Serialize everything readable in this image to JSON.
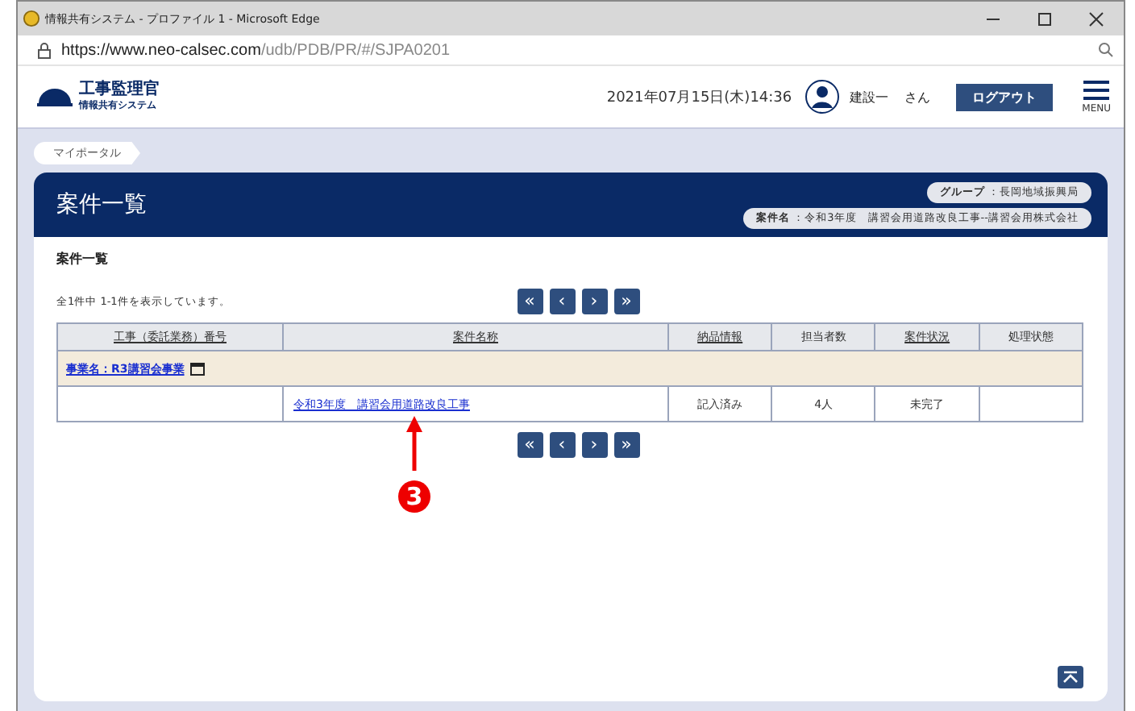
{
  "window": {
    "title": "情報共有システム - プロファイル 1 - Microsoft Edge",
    "url_host": "https://www.neo-calsec.com",
    "url_path": "/udb/PDB/PR/#/SJPA0201"
  },
  "header": {
    "logo_title": "工事監理官",
    "logo_subtitle": "情報共有システム",
    "datetime": "2021年07月15日(木)14:36",
    "user": "建設一",
    "honorific": "さん",
    "logout": "ログアウト",
    "menu": "MENU"
  },
  "breadcrumb": [
    "マイポータル"
  ],
  "panel": {
    "title": "案件一覧",
    "group_label": "グループ",
    "group_value": "：長岡地域振興局",
    "case_label": "案件名",
    "case_value": "：令和3年度　講習会用道路改良工事--講習会用株式会社"
  },
  "section_title": "案件一覧",
  "result_count": "全1件中 1-1件を表示しています。",
  "pager": [
    "«",
    "‹",
    "›",
    "»"
  ],
  "table": {
    "columns": [
      {
        "label": "工事（委託業務）番号",
        "sortable": true
      },
      {
        "label": "案件名称",
        "sortable": true
      },
      {
        "label": "納品情報",
        "sortable": true
      },
      {
        "label": "担当者数",
        "sortable": false
      },
      {
        "label": "案件状況",
        "sortable": true
      },
      {
        "label": "処理状態",
        "sortable": false
      }
    ],
    "groups": [
      {
        "label": "事業名：R3講習会事業",
        "rows": [
          [
            "",
            "令和3年度　講習会用道路改良工事",
            "記入済み",
            "4人",
            "未完了",
            ""
          ]
        ]
      }
    ]
  },
  "annotation": {
    "number": "3"
  }
}
